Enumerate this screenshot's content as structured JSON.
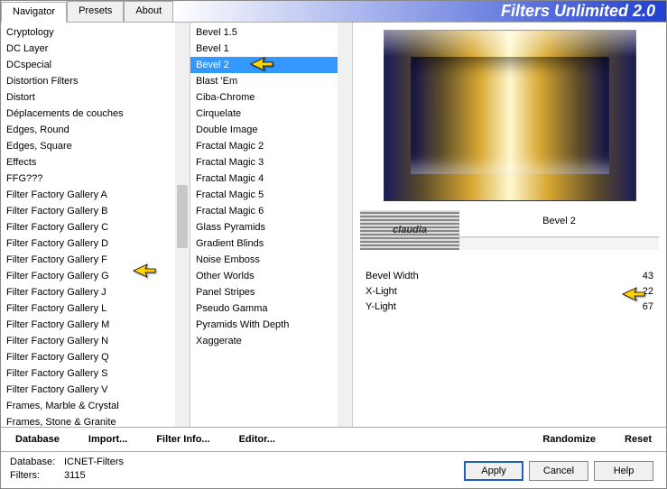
{
  "app": {
    "title": "Filters Unlimited 2.0"
  },
  "tabs": [
    "Navigator",
    "Presets",
    "About"
  ],
  "activeTab": 0,
  "categories": [
    "Cryptology",
    "DC Layer",
    "DCspecial",
    "Distortion Filters",
    "Distort",
    "Déplacements de couches",
    "Edges, Round",
    "Edges, Square",
    "Effects",
    "FFG???",
    "Filter Factory Gallery A",
    "Filter Factory Gallery B",
    "Filter Factory Gallery C",
    "Filter Factory Gallery D",
    "Filter Factory Gallery F",
    "Filter Factory Gallery G",
    "Filter Factory Gallery J",
    "Filter Factory Gallery L",
    "Filter Factory Gallery M",
    "Filter Factory Gallery N",
    "Filter Factory Gallery Q",
    "Filter Factory Gallery S",
    "Filter Factory Gallery V",
    "Frames, Marble & Crystal",
    "Frames, Stone & Granite"
  ],
  "filters": [
    "Bevel 1.5",
    "Bevel 1",
    "Bevel 2",
    "Blast 'Em",
    "Ciba-Chrome",
    "Cirquelate",
    "Double Image",
    "Fractal Magic 2",
    "Fractal Magic 3",
    "Fractal Magic 4",
    "Fractal Magic 5",
    "Fractal Magic 6",
    "Glass Pyramids",
    "Gradient Blinds",
    "Noise Emboss",
    "Other Worlds",
    "Panel Stripes",
    "Pseudo Gamma",
    "Pyramids With Depth",
    "Xaggerate"
  ],
  "selectedFilterIndex": 2,
  "watermark": "claudia",
  "filterName": "Bevel 2",
  "params": [
    {
      "label": "Bevel Width",
      "value": 43
    },
    {
      "label": "X-Light",
      "value": 22
    },
    {
      "label": "Y-Light",
      "value": 67
    }
  ],
  "bottom": {
    "database": "Database",
    "import": "Import...",
    "filterinfo": "Filter Info...",
    "editor": "Editor...",
    "randomize": "Randomize",
    "reset": "Reset"
  },
  "status": {
    "dbLabel": "Database:",
    "dbValue": "ICNET-Filters",
    "fLabel": "Filters:",
    "fValue": "3115"
  },
  "buttons": {
    "apply": "Apply",
    "cancel": "Cancel",
    "help": "Help"
  }
}
